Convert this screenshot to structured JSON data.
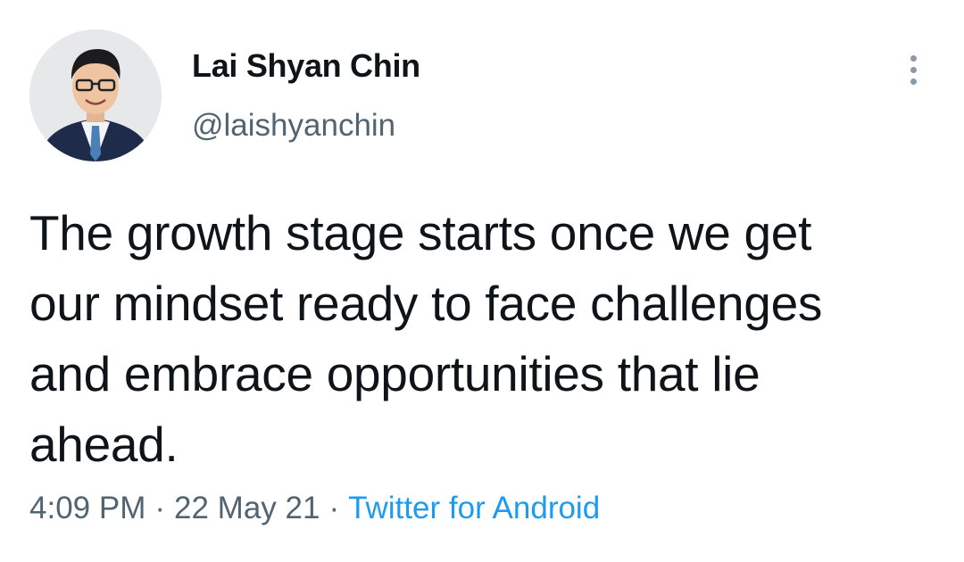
{
  "author": {
    "display_name": "Lai Shyan Chin",
    "handle": "@laishyanchin",
    "avatar_icon": "profile-photo"
  },
  "more_icon": "more-vertical-icon",
  "tweet": {
    "text": "The growth stage starts once we get\nour mindset ready to face challenges\nand embrace opportunities that lie\nahead."
  },
  "meta": {
    "time": "4:09 PM",
    "separator": "·",
    "date": "22 May 21",
    "source": "Twitter for Android"
  },
  "colors": {
    "text": "#0f1419",
    "secondary": "#536471",
    "link": "#1d9bf0"
  }
}
